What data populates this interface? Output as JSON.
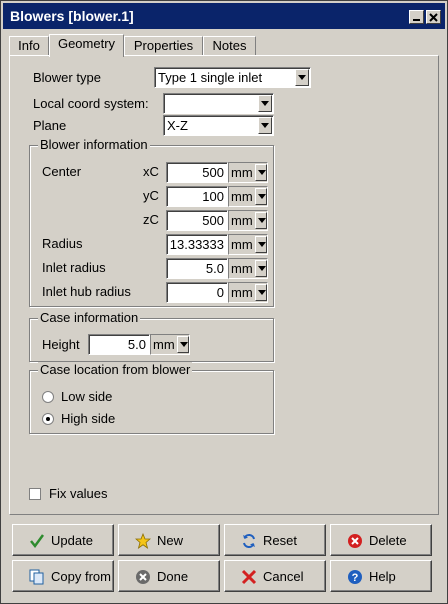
{
  "window": {
    "title": "Blowers [blower.1]"
  },
  "tabs": [
    {
      "label": "Info"
    },
    {
      "label": "Geometry"
    },
    {
      "label": "Properties"
    },
    {
      "label": "Notes"
    }
  ],
  "form": {
    "blower_type_label": "Blower type",
    "blower_type_value": "Type 1 single inlet",
    "local_coord_label": "Local coord system:",
    "local_coord_value": "",
    "plane_label": "Plane",
    "plane_value": "X-Z"
  },
  "blower_info": {
    "title": "Blower information",
    "center_label": "Center",
    "xc_label": "xC",
    "xc_value": "500",
    "xc_unit": "mm",
    "yc_label": "yC",
    "yc_value": "100",
    "yc_unit": "mm",
    "zc_label": "zC",
    "zc_value": "500",
    "zc_unit": "mm",
    "radius_label": "Radius",
    "radius_value": "13.33333",
    "radius_unit": "mm",
    "inlet_radius_label": "Inlet radius",
    "inlet_radius_value": "5.0",
    "inlet_radius_unit": "mm",
    "inlet_hub_label": "Inlet hub radius",
    "inlet_hub_value": "0",
    "inlet_hub_unit": "mm"
  },
  "case_info": {
    "title": "Case information",
    "height_label": "Height",
    "height_value": "5.0",
    "height_unit": "mm"
  },
  "case_location": {
    "title": "Case location from blower",
    "low_label": "Low side",
    "high_label": "High side",
    "selected": "High side"
  },
  "fix_values": {
    "label": "Fix values",
    "checked": false
  },
  "buttons": {
    "update": "Update",
    "new": "New",
    "reset": "Reset",
    "delete": "Delete",
    "copy_from": "Copy from",
    "done": "Done",
    "cancel": "Cancel",
    "help": "Help"
  },
  "colors": {
    "titlebar": "#0a246a",
    "face": "#d4d0c8"
  }
}
